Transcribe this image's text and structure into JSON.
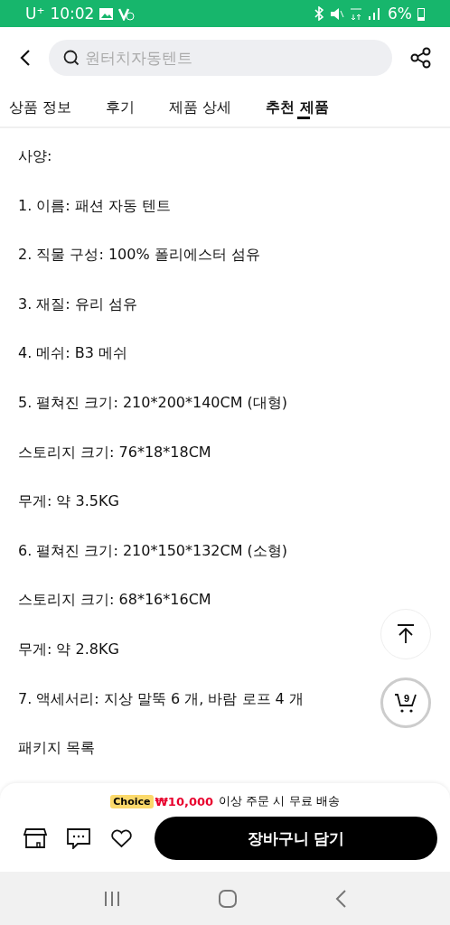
{
  "status_bar": {
    "carrier": "U⁺",
    "time": "10:02",
    "battery": "6%"
  },
  "search": {
    "placeholder": "원터치자동텐트"
  },
  "tabs": [
    {
      "label": "상품 정보",
      "selected": false
    },
    {
      "label": "후기",
      "selected": false
    },
    {
      "label": "제품 상세",
      "selected": false
    },
    {
      "label": "추천 제품",
      "selected": true
    }
  ],
  "spec_lines": [
    "사양:",
    "1. 이름: 패션 자동 텐트",
    "2. 직물 구성: 100% 폴리에스터 섬유",
    "3. 재질: 유리 섬유",
    "4. 메쉬: B3 메쉬",
    "5. 펼쳐진 크기: 210*200*140CM (대형)",
    "스토리지 크기: 76*18*18CM",
    "무게: 약 3.5KG",
    "6. 펼쳐진 크기: 210*150*132CM (소형)",
    "스토리지 크기: 68*16*16CM",
    "무게: 약 2.8KG",
    "7. 액세서리: 지상 말뚝 6 개, 바람 로프 4 개",
    "패키지 목록"
  ],
  "cart_count": "9",
  "promo": {
    "badge": "Choice",
    "amount": "₩10,000",
    "text": "이상 주문 시 무료 배송"
  },
  "add_to_cart": "장바구니 담기"
}
